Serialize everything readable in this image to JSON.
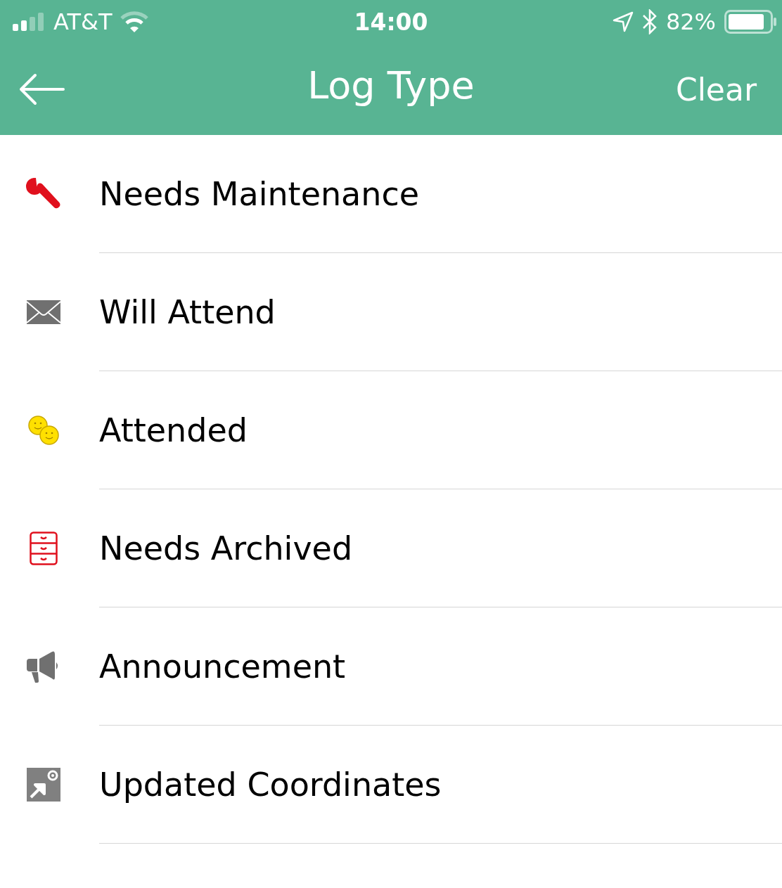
{
  "status_bar": {
    "carrier": "AT&T",
    "time": "14:00",
    "battery": "82%"
  },
  "nav": {
    "title": "Log Type",
    "action": "Clear"
  },
  "items": [
    {
      "kind": "wrench",
      "label": "Needs Maintenance"
    },
    {
      "kind": "envelope",
      "label": "Will Attend"
    },
    {
      "kind": "smileys",
      "label": "Attended"
    },
    {
      "kind": "cabinet",
      "label": "Needs Archived"
    },
    {
      "kind": "megaphone",
      "label": "Announcement"
    },
    {
      "kind": "location",
      "label": "Updated Coordinates"
    }
  ]
}
